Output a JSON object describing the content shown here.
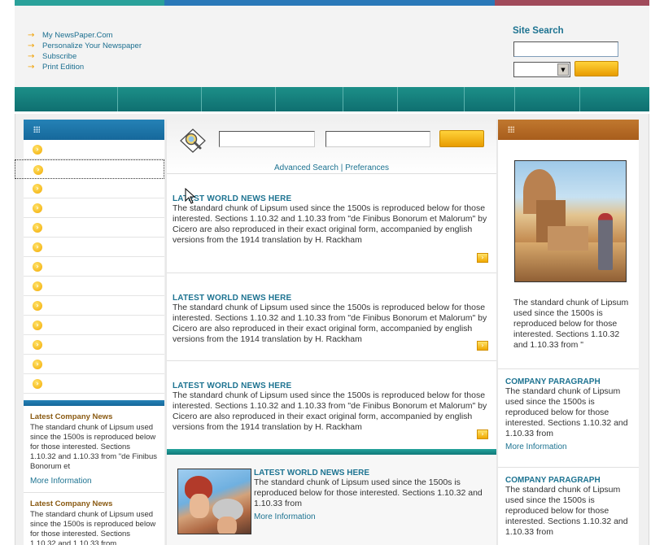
{
  "colors": {
    "teal": "#1d7391",
    "topbar_green": "#2aa19a",
    "topbar_blue": "#2a78b8",
    "topbar_maroon": "#a04a5a",
    "orange_accent": "#f0a800",
    "brown_header": "#a85d1c",
    "blue_header": "#16689b"
  },
  "header": {
    "links": [
      {
        "label": "My NewsPaper.Com"
      },
      {
        "label": "Personalize Your Newspaper"
      },
      {
        "label": "Subscribe"
      },
      {
        "label": "Print Edition"
      }
    ],
    "site_search": {
      "title": "Site Search",
      "input_value": "",
      "select_value": ""
    }
  },
  "center": {
    "search": {
      "advanced_label": "Advanced Search",
      "separator": "|",
      "preferences_label": "Preferances"
    },
    "articles": [
      {
        "title": "LATEST WORLD NEWS HERE",
        "body": "The standard chunk of Lipsum used since the 1500s is reproduced below for those interested. Sections 1.10.32 and 1.10.33 from \"de Finibus Bonorum et Malorum\" by Cicero are also reproduced in their exact original form, accompanied by english versions from the 1914 translation by H. Rackham"
      },
      {
        "title": "LATEST WORLD NEWS HERE",
        "body": "The standard chunk of Lipsum used since the 1500s is reproduced below for those interested. Sections 1.10.32 and 1.10.33 from \"de Finibus Bonorum et Malorum\" by Cicero are also reproduced in their exact original form, accompanied by english versions from the 1914 translation by H. Rackham"
      },
      {
        "title": "LATEST WORLD NEWS HERE",
        "body": "The standard chunk of Lipsum used since the 1500s is reproduced below for those interested. Sections 1.10.32 and 1.10.33 from \"de Finibus Bonorum et Malorum\" by Cicero are also reproduced in their exact original form, accompanied by english versions from the 1914 translation by H. Rackham"
      }
    ],
    "feature": {
      "title": "LATEST WORLD NEWS HERE",
      "body": "The standard chunk of Lipsum used since the 1500s is reproduced below for those interested. Sections 1.10.32 and 1.10.33 from",
      "more": "More Information"
    }
  },
  "left": {
    "company_news": [
      {
        "title": "Latest Company News",
        "body": "The standard chunk of Lipsum used since the 1500s is reproduced below for those interested. Sections 1.10.32 and 1.10.33 from \"de Finibus Bonorum et",
        "more": "More Information"
      },
      {
        "title": "Latest Company News",
        "body": "The standard chunk of Lipsum used since the 1500s is reproduced below for those interested. Sections 1.10.32 and 1.10.33 from",
        "more": ""
      }
    ]
  },
  "right": {
    "caption": "The standard chunk of Lipsum used since the 1500s is reproduced below for those interested. Sections 1.10.32 and 1.10.33 from \"",
    "paragraphs": [
      {
        "title": "COMPANY PARAGRAPH",
        "body": "The standard chunk of Lipsum used since the 1500s is reproduced below for those interested. Sections 1.10.32 and 1.10.33 from",
        "more": "More Information"
      },
      {
        "title": "COMPANY PARAGRAPH",
        "body": "The standard chunk of Lipsum used since the 1500s is reproduced below for those interested. Sections 1.10.32 and 1.10.33 from",
        "more": ""
      }
    ]
  }
}
